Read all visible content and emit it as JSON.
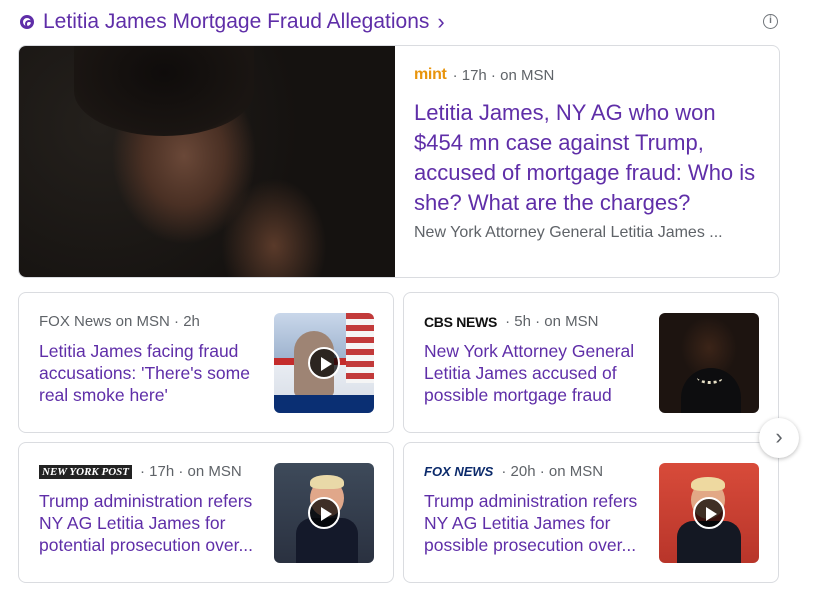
{
  "header": {
    "title": "Letitia James Mortgage Fraud Allegations",
    "chevron": "›",
    "info_icon": "i"
  },
  "hero": {
    "source": "mint",
    "meta": "· 17h · on MSN",
    "title": "Letitia James, NY AG who won $454 mn case against Trump, accused of mortgage fraud: Who is she? What are the charges?",
    "snippet": "New York Attorney General Letitia James ..."
  },
  "cards": [
    {
      "source": "FOX News on MSN",
      "meta": "· 2h",
      "title": "Letitia James facing fraud accusations: 'There's some real smoke here'",
      "video": true
    },
    {
      "source": "CBS NEWS",
      "meta": "· 5h · on MSN",
      "title": "New York Attorney General Letitia James accused of possible mortgage fraud",
      "video": false
    },
    {
      "source": "NEW YORK POST",
      "meta": "· 17h · on MSN",
      "title": "Trump administration refers NY AG Letitia James for potential prosecution over...",
      "video": true
    },
    {
      "source": "FOX NEWS",
      "meta": "· 20h · on MSN",
      "title": "Trump administration refers NY AG Letitia James for possible prosecution over...",
      "video": true
    }
  ],
  "next_button": "›",
  "colors": {
    "link": "#5f2ea8",
    "meta": "#5f6368",
    "border": "#dadce0"
  }
}
